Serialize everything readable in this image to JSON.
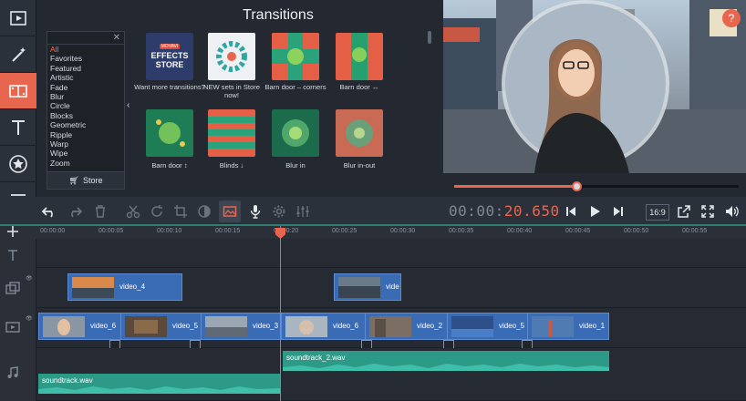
{
  "transitions": {
    "title": "Transitions",
    "categories": [
      "All",
      "Favorites",
      "Featured",
      "Artistic",
      "Fade",
      "Blur",
      "Circle",
      "Blocks",
      "Geometric",
      "Ripple",
      "Warp",
      "Wipe",
      "Zoom"
    ],
    "store_label": "Store",
    "store_tile": {
      "badge": "MOVAVI",
      "line1": "EFFECTS",
      "line2": "STORE"
    },
    "tiles": [
      {
        "label": "Want more transitions?"
      },
      {
        "label": "NEW sets in Store now!"
      },
      {
        "label": "Barn door – corners"
      },
      {
        "label": "Barn door ↔"
      },
      {
        "label": "Barn door ↕"
      },
      {
        "label": "Blinds ↓"
      },
      {
        "label": "Blur in"
      },
      {
        "label": "Blur in-out"
      }
    ]
  },
  "preview": {
    "help": "?",
    "progress": 0.43
  },
  "player": {
    "timecode_dim": "00:00:",
    "timecode_hot": "20.650",
    "aspect": "16:9"
  },
  "ruler": [
    "00:00:00",
    "00:00:05",
    "00:00:10",
    "00:00:15",
    "00:00:20",
    "00:00:25",
    "00:00:30",
    "00:00:35",
    "00:00:40",
    "00:00:45",
    "00:00:50",
    "00:00:55"
  ],
  "clips": {
    "overlay": [
      "video_4",
      "vide"
    ],
    "main": [
      "video_6",
      "video_5",
      "video_3",
      "video_6",
      "video_2",
      "video_5",
      "video_1"
    ]
  },
  "audio": [
    "soundtrack.wav",
    "soundtrack_2.wav"
  ],
  "colors": {
    "accent": "#e8664e",
    "clip": "#3a6bb5",
    "audio": "#2d9a88"
  }
}
